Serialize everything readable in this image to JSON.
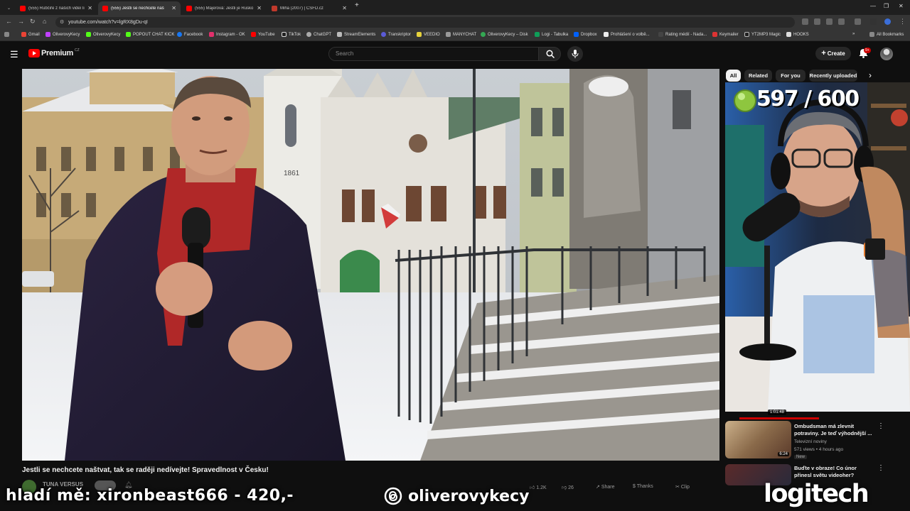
{
  "browser": {
    "tabs": [
      {
        "title": "(555) Rubčiře z našich videí li",
        "active": false
      },
      {
        "title": "(555) Jestli se nechcete naš",
        "active": true
      },
      {
        "title": "(555) Majerová: Jestli je Rusko",
        "active": false
      },
      {
        "title": "Miha (2007) | ČSFD.cz",
        "active": false
      }
    ],
    "url": "youtube.com/watch?v=lgRX8gDu-qI",
    "bookmarks": [
      "Gmail",
      "OliverovyKecy",
      "OliverovyKecy",
      "POPOUT CHAT KICK",
      "Facebook",
      "Instagram - OK",
      "YouTube",
      "TikTok",
      "ChatGPT",
      "StreamElements",
      "Transkriptor",
      "VEEDIO",
      "MANYCHAT",
      "OliverovyKecy – Disk",
      "Logi - Tabulka",
      "Dropbox",
      "Prohlášení o volbě...",
      "Rating médií - Nada...",
      "Keymailer",
      "YT2MP3 Magic",
      "HOOKS"
    ],
    "all_bookmarks": "All Bookmarks"
  },
  "youtube": {
    "logo": "Premium",
    "logo_region": "CZ",
    "search_placeholder": "Search",
    "create_label": "Create",
    "notif_badge": "9+",
    "chips": [
      "All",
      "Related",
      "For you",
      "Recently uploaded"
    ],
    "video": {
      "title": "Jestli se nechcete naštvat, tak se raději nedívejte! Spravedlnost v Česku!",
      "channel": "TUNA VERSUS",
      "year_on_building": "1861",
      "actions": [
        "1.2K",
        "26",
        "Share",
        "Thanks",
        "Clip"
      ]
    },
    "recommendations": [
      {
        "duration": "1:01:48",
        "title": "Ombudsman má zlevnit potraviny. Je teď výhodnější ...",
        "channel": "Televizní noviny",
        "meta": "571 views • 4 hours ago",
        "badge": "New",
        "thumb_duration": "6:24"
      },
      {
        "title": "Buďte v obraze! Co únor přinesl světu videoher?",
        "duration": ""
      }
    ]
  },
  "webcam": {
    "counter": "597 / 600"
  },
  "overlays": {
    "left_text": "hladí mě: xironbeast666 - 420,-",
    "threads_handle": "oliverovykecy",
    "brand": "logitech"
  },
  "colors": {
    "yt_red": "#ff0000",
    "bg": "#0f0f0f",
    "counter_green": "#8ec63f"
  }
}
